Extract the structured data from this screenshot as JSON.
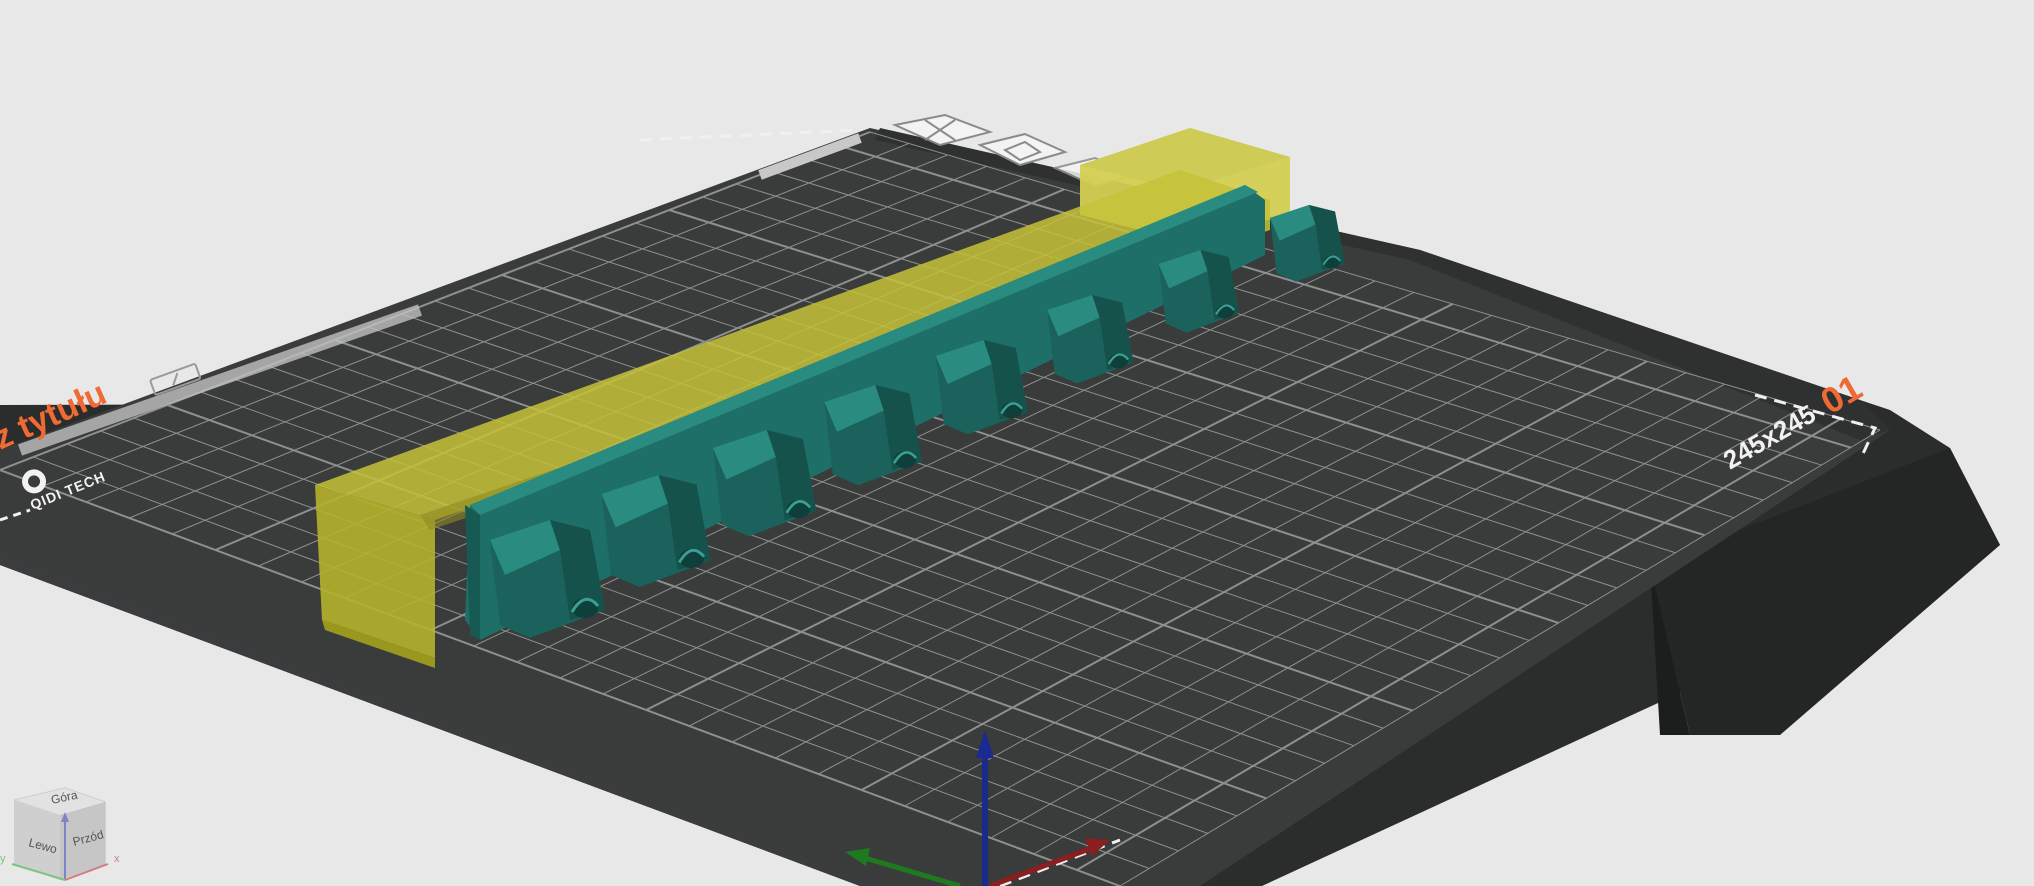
{
  "plate": {
    "title_fragment": "z tytułu",
    "number": "01",
    "size_label": "245x245",
    "brand": "QIDI TECH"
  },
  "plate_toolbar": {
    "icons": [
      "close-icon",
      "auto-orient-icon",
      "arrange-icon",
      "lock-icon",
      "settings-icon"
    ]
  },
  "view_cube": {
    "left_label": "Lewo",
    "front_label": "Przód",
    "top_label": "Góra",
    "x_letter": "x",
    "y_letter": "y"
  },
  "colors": {
    "background": "#e8e8e8",
    "plate_dark": "#3a3b3b",
    "bed_body": "#2b2c2c",
    "grid_line": "#8e9090",
    "model_teal": "#1f6e66",
    "selection_yellow": "#c8c43a",
    "accent_orange": "#ef6a35"
  }
}
